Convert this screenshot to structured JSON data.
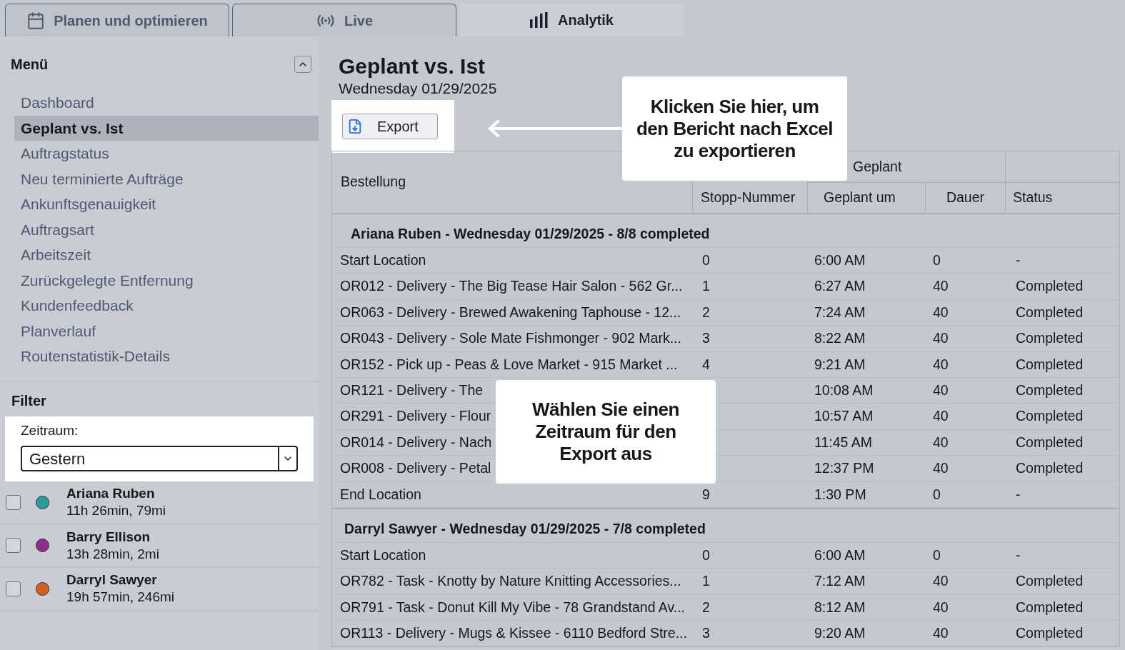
{
  "tabs": [
    {
      "label": "Planen und optimieren",
      "selected": false
    },
    {
      "label": "Live",
      "selected": false
    },
    {
      "label": "Analytik",
      "selected": true
    }
  ],
  "sidebar": {
    "menu_title": "Menü",
    "items": [
      {
        "label": "Dashboard",
        "selected": false
      },
      {
        "label": "Geplant vs. Ist",
        "selected": true
      },
      {
        "label": "Auftragstatus",
        "selected": false
      },
      {
        "label": "Neu terminierte Aufträge",
        "selected": false
      },
      {
        "label": "Ankunftsgenauigkeit",
        "selected": false
      },
      {
        "label": "Auftragsart",
        "selected": false
      },
      {
        "label": "Arbeitszeit",
        "selected": false
      },
      {
        "label": "Zurückgelegte Entfernung",
        "selected": false
      },
      {
        "label": "Kundenfeedback",
        "selected": false
      },
      {
        "label": "Planverlauf",
        "selected": false
      },
      {
        "label": "Routenstatistik-Details",
        "selected": false
      }
    ],
    "filter_title": "Filter",
    "period_label": "Zeitraum:",
    "period_value": "Gestern",
    "drivers": [
      {
        "name": "Ariana Ruben",
        "summary": "11h 26min, 79mi",
        "color": "#2b9b9b",
        "checked": false
      },
      {
        "name": "Barry Ellison",
        "summary": "13h 28min, 2mi",
        "color": "#8e2d8e",
        "checked": false
      },
      {
        "name": "Darryl Sawyer",
        "summary": "19h 57min, 246mi",
        "color": "#d35f1f",
        "checked": false
      }
    ]
  },
  "main": {
    "title": "Geplant vs. Ist",
    "date": "Wednesday 01/29/2025",
    "export_button": "Export",
    "table": {
      "group_header": "Geplant",
      "columns": [
        "Bestellung",
        "Stopp-Nummer",
        "Geplant um",
        "Dauer",
        "Status"
      ],
      "groups": [
        {
          "title": "Ariana Ruben - Wednesday 01/29/2025 - 8/8 completed",
          "rows": [
            [
              "Start Location",
              "0",
              "6:00 AM",
              "0",
              "-"
            ],
            [
              "OR012 - Delivery - The Big Tease Hair Salon - 562 Gr...",
              "1",
              "6:27 AM",
              "40",
              "Completed"
            ],
            [
              "OR063 - Delivery - Brewed Awakening Taphouse - 12...",
              "2",
              "7:24 AM",
              "40",
              "Completed"
            ],
            [
              "OR043 - Delivery - Sole Mate Fishmonger - 902 Mark...",
              "3",
              "8:22 AM",
              "40",
              "Completed"
            ],
            [
              "OR152 - Pick up - Peas & Love Market - 915 Market ...",
              "4",
              "9:21 AM",
              "40",
              "Completed"
            ],
            [
              "OR121 - Delivery - The",
              "",
              "10:08 AM",
              "40",
              "Completed"
            ],
            [
              "OR291 - Delivery - Flour",
              "",
              "10:57 AM",
              "40",
              "Completed"
            ],
            [
              "OR014 - Delivery - Nach",
              "",
              "11:45 AM",
              "40",
              "Completed"
            ],
            [
              "OR008 - Delivery - Petal",
              "",
              "12:37 PM",
              "40",
              "Completed"
            ],
            [
              "End Location",
              "9",
              "1:30 PM",
              "0",
              "-"
            ]
          ]
        },
        {
          "title": "Darryl Sawyer - Wednesday 01/29/2025 - 7/8 completed",
          "rows": [
            [
              "Start Location",
              "0",
              "6:00 AM",
              "0",
              "-"
            ],
            [
              "OR782 - Task - Knotty by Nature Knitting Accessories...",
              "1",
              "7:12 AM",
              "40",
              "Completed"
            ],
            [
              "OR791 - Task - Donut Kill My Vibe - 78 Grandstand Av...",
              "2",
              "8:12 AM",
              "40",
              "Completed"
            ],
            [
              "OR113 - Delivery - Mugs & Kissee - 6110 Bedford Stre...",
              "3",
              "9:20 AM",
              "40",
              "Completed"
            ]
          ]
        }
      ]
    }
  },
  "callouts": [
    {
      "text": "Klicken Sie hier, um den Bericht nach Excel zu exportieren"
    },
    {
      "text": "Wählen Sie einen Zeitraum für den Export aus"
    }
  ]
}
